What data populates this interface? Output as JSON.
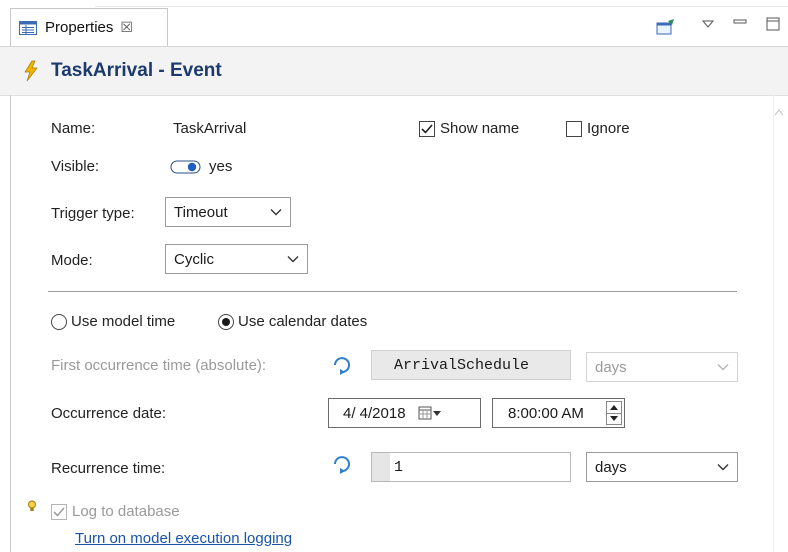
{
  "tab": {
    "label": "Properties",
    "close_glyph": "☒"
  },
  "toolbar": {
    "icons": [
      "pin-editor-icon",
      "view-menu-icon",
      "minimize-icon",
      "maximize-icon"
    ]
  },
  "header": {
    "icon": "lightning-bolt-icon",
    "title": "TaskArrival - Event",
    "title_color": "#1c3a6e",
    "icon_color": "#f2b400"
  },
  "form": {
    "name": {
      "label": "Name:",
      "value": "TaskArrival"
    },
    "show_name": {
      "label": "Show name",
      "checked": true
    },
    "ignore": {
      "label": "Ignore",
      "checked": false
    },
    "visible": {
      "label": "Visible:",
      "value": "yes"
    },
    "trigger_type": {
      "label": "Trigger type:",
      "value": "Timeout"
    },
    "mode": {
      "label": "Mode:",
      "value": "Cyclic"
    },
    "time_mode": {
      "option_model": "Use model time",
      "option_calendar": "Use calendar dates",
      "selected": "Use calendar dates"
    },
    "first_occurrence": {
      "label": "First occurrence time (absolute):",
      "value": "ArrivalSchedule",
      "unit": "days",
      "disabled": true
    },
    "occurrence_date": {
      "label": "Occurrence date:",
      "date": "4/ 4/2018",
      "time": "8:00:00 AM"
    },
    "recurrence_time": {
      "label": "Recurrence time:",
      "value": "1",
      "unit": "days"
    },
    "log_to_database": {
      "label": "Log to database",
      "checked": true,
      "disabled": true
    },
    "logging_link": "Turn on model execution logging"
  }
}
